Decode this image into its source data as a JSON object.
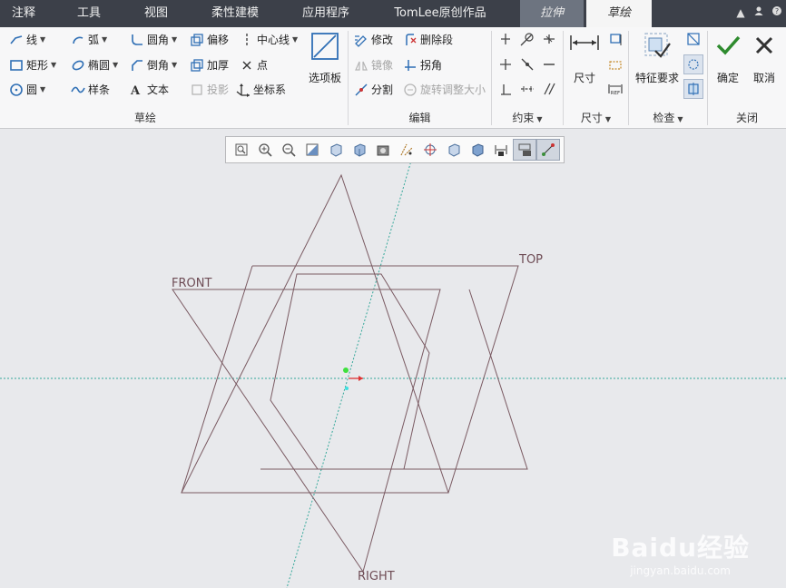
{
  "menu": {
    "tabs": [
      "注释",
      "工具",
      "视图",
      "柔性建模",
      "应用程序",
      "TomLee原创作品"
    ],
    "context_tab": "拉伸",
    "active_tab": "草绘"
  },
  "ribbon": {
    "sketch": {
      "label": "草绘",
      "line": "线",
      "arc": "弧",
      "fillet": "圆角",
      "offset": "偏移",
      "centerline": "中心线",
      "rectangle": "矩形",
      "ellipse": "椭圆",
      "chamfer": "倒角",
      "thicken": "加厚",
      "point": "点",
      "circle": "圆",
      "spline": "样条",
      "text": "文本",
      "project": "投影",
      "coordsys": "坐标系",
      "palette": "选项板"
    },
    "edit": {
      "label": "编辑",
      "modify": "修改",
      "delete_segment": "删除段",
      "mirror": "镜像",
      "corner": "拐角",
      "divide": "分割",
      "rotate_resize": "旋转调整大小"
    },
    "constrain": {
      "label": "约束"
    },
    "dimension": {
      "label": "尺寸",
      "button": "尺寸"
    },
    "inspect": {
      "label": "检查",
      "feature_req": "特征要求"
    },
    "close": {
      "label": "关闭",
      "ok": "确定",
      "cancel": "取消"
    }
  },
  "canvas": {
    "planes": {
      "front": "FRONT",
      "top": "TOP",
      "right": "RIGHT"
    }
  },
  "watermark": {
    "brand": "Baidu经验",
    "url": "jingyan.baidu.com"
  }
}
